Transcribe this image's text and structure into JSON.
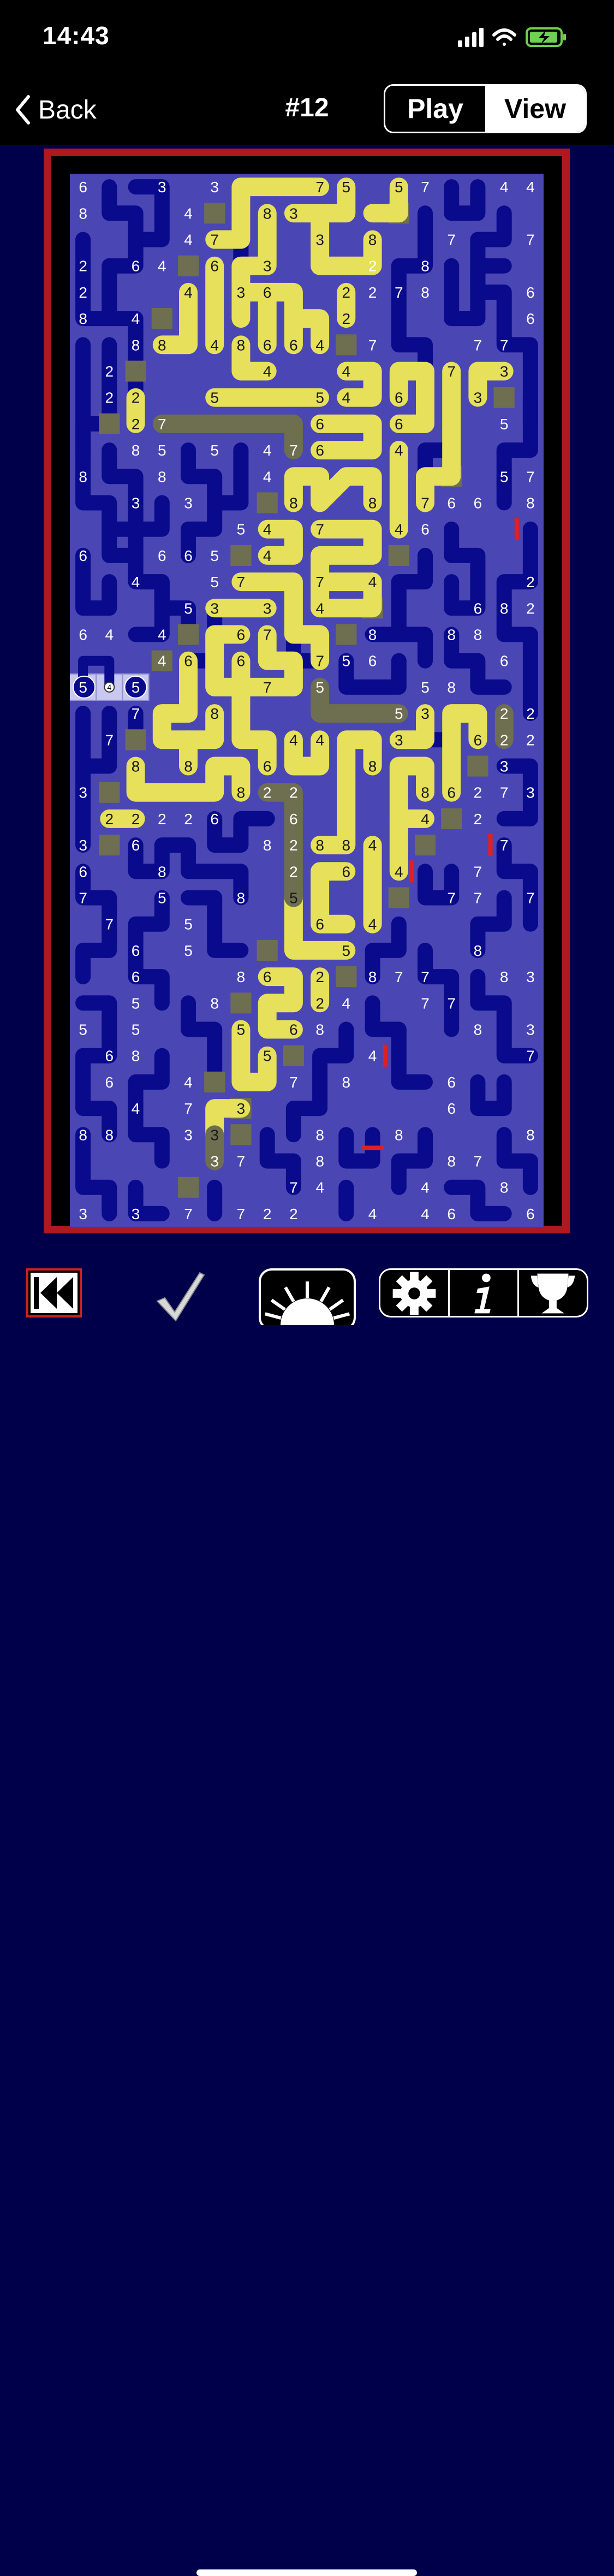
{
  "status": {
    "time": "14:43"
  },
  "nav": {
    "back": "Back",
    "title": "#12",
    "play": "Play",
    "view": "View"
  },
  "colors": {
    "path": "#e6e05a",
    "gray": "#6e6e50",
    "cell": "#4a46b4",
    "pipe": "#0a0a8c",
    "marker": "#e02020",
    "selected": "#c8c8f0"
  },
  "puzzle": {
    "cols": 18,
    "rows": 40,
    "numbers": [
      [
        0,
        0,
        "6",
        "w"
      ],
      [
        0,
        3,
        "3",
        "w"
      ],
      [
        0,
        5,
        "3",
        "w"
      ],
      [
        0,
        9,
        "7",
        "d"
      ],
      [
        0,
        10,
        "5",
        "d"
      ],
      [
        0,
        12,
        "5",
        "d"
      ],
      [
        0,
        13,
        "7",
        "w"
      ],
      [
        0,
        16,
        "4",
        "w"
      ],
      [
        0,
        17,
        "4",
        "w"
      ],
      [
        1,
        0,
        "8",
        "w"
      ],
      [
        1,
        4,
        "4",
        "w"
      ],
      [
        1,
        7,
        "8",
        "d"
      ],
      [
        1,
        8,
        "3",
        "d"
      ],
      [
        2,
        4,
        "4",
        "w"
      ],
      [
        2,
        5,
        "7",
        "d"
      ],
      [
        2,
        9,
        "3",
        "d"
      ],
      [
        2,
        11,
        "8",
        "d"
      ],
      [
        2,
        14,
        "7",
        "w"
      ],
      [
        2,
        17,
        "7",
        "w"
      ],
      [
        3,
        0,
        "2",
        "w"
      ],
      [
        3,
        2,
        "6",
        "w"
      ],
      [
        3,
        3,
        "4",
        "w"
      ],
      [
        3,
        5,
        "6",
        "d"
      ],
      [
        3,
        7,
        "3",
        "d"
      ],
      [
        3,
        11,
        "2",
        "w"
      ],
      [
        3,
        13,
        "8",
        "w"
      ],
      [
        4,
        0,
        "2",
        "w"
      ],
      [
        4,
        4,
        "4",
        "d"
      ],
      [
        4,
        6,
        "3",
        "d"
      ],
      [
        4,
        7,
        "6",
        "d"
      ],
      [
        4,
        10,
        "2",
        "d"
      ],
      [
        4,
        11,
        "2",
        "w"
      ],
      [
        4,
        12,
        "7",
        "w"
      ],
      [
        4,
        13,
        "8",
        "w"
      ],
      [
        4,
        17,
        "6",
        "w"
      ],
      [
        5,
        0,
        "8",
        "w"
      ],
      [
        5,
        2,
        "4",
        "w"
      ],
      [
        5,
        10,
        "2",
        "d"
      ],
      [
        5,
        17,
        "6",
        "w"
      ],
      [
        6,
        2,
        "8",
        "w"
      ],
      [
        6,
        3,
        "8",
        "d"
      ],
      [
        6,
        5,
        "4",
        "d"
      ],
      [
        6,
        6,
        "8",
        "d"
      ],
      [
        6,
        7,
        "6",
        "d"
      ],
      [
        6,
        8,
        "6",
        "d"
      ],
      [
        6,
        9,
        "4",
        "d"
      ],
      [
        6,
        11,
        "7",
        "w"
      ],
      [
        6,
        15,
        "7",
        "w"
      ],
      [
        6,
        16,
        "7",
        "w"
      ],
      [
        7,
        1,
        "2",
        "w"
      ],
      [
        7,
        7,
        "4",
        "d"
      ],
      [
        7,
        10,
        "4",
        "d"
      ],
      [
        7,
        14,
        "7",
        "d"
      ],
      [
        7,
        16,
        "3",
        "d"
      ],
      [
        8,
        1,
        "2",
        "w"
      ],
      [
        8,
        2,
        "2",
        "d"
      ],
      [
        8,
        5,
        "5",
        "d"
      ],
      [
        8,
        9,
        "5",
        "d"
      ],
      [
        8,
        10,
        "4",
        "d"
      ],
      [
        8,
        12,
        "6",
        "d"
      ],
      [
        8,
        15,
        "3",
        "d"
      ],
      [
        9,
        2,
        "2",
        "d"
      ],
      [
        9,
        3,
        "7",
        "w"
      ],
      [
        9,
        9,
        "6",
        "d"
      ],
      [
        9,
        12,
        "6",
        "d"
      ],
      [
        9,
        16,
        "5",
        "w"
      ],
      [
        10,
        2,
        "8",
        "w"
      ],
      [
        10,
        3,
        "5",
        "w"
      ],
      [
        10,
        5,
        "5",
        "w"
      ],
      [
        10,
        7,
        "4",
        "w"
      ],
      [
        10,
        8,
        "7",
        "w"
      ],
      [
        10,
        9,
        "6",
        "d"
      ],
      [
        10,
        12,
        "4",
        "d"
      ],
      [
        11,
        0,
        "8",
        "w"
      ],
      [
        11,
        3,
        "8",
        "w"
      ],
      [
        11,
        7,
        "4",
        "w"
      ],
      [
        11,
        16,
        "5",
        "w"
      ],
      [
        11,
        17,
        "7",
        "w"
      ],
      [
        12,
        2,
        "3",
        "w"
      ],
      [
        12,
        4,
        "3",
        "w"
      ],
      [
        12,
        8,
        "8",
        "d"
      ],
      [
        12,
        11,
        "8",
        "d"
      ],
      [
        12,
        13,
        "7",
        "d"
      ],
      [
        12,
        14,
        "6",
        "w"
      ],
      [
        12,
        15,
        "6",
        "w"
      ],
      [
        12,
        17,
        "8",
        "w"
      ],
      [
        13,
        6,
        "5",
        "w"
      ],
      [
        13,
        7,
        "4",
        "d"
      ],
      [
        13,
        9,
        "7",
        "d"
      ],
      [
        13,
        12,
        "4",
        "d"
      ],
      [
        13,
        13,
        "6",
        "w"
      ],
      [
        14,
        0,
        "6",
        "w"
      ],
      [
        14,
        3,
        "6",
        "w"
      ],
      [
        14,
        4,
        "6",
        "w"
      ],
      [
        14,
        5,
        "5",
        "w"
      ],
      [
        14,
        7,
        "4",
        "d"
      ],
      [
        15,
        2,
        "4",
        "w"
      ],
      [
        15,
        5,
        "5",
        "w"
      ],
      [
        15,
        6,
        "7",
        "d"
      ],
      [
        15,
        9,
        "7",
        "d"
      ],
      [
        15,
        11,
        "4",
        "d"
      ],
      [
        15,
        17,
        "2",
        "w"
      ],
      [
        16,
        4,
        "5",
        "w"
      ],
      [
        16,
        5,
        "3",
        "d"
      ],
      [
        16,
        7,
        "3",
        "d"
      ],
      [
        16,
        9,
        "4",
        "d"
      ],
      [
        16,
        15,
        "6",
        "w"
      ],
      [
        16,
        16,
        "8",
        "w"
      ],
      [
        16,
        17,
        "2",
        "w"
      ],
      [
        17,
        0,
        "6",
        "w"
      ],
      [
        17,
        1,
        "4",
        "w"
      ],
      [
        17,
        3,
        "4",
        "w"
      ],
      [
        17,
        6,
        "6",
        "d"
      ],
      [
        17,
        7,
        "7",
        "d"
      ],
      [
        17,
        11,
        "8",
        "w"
      ],
      [
        17,
        14,
        "8",
        "w"
      ],
      [
        17,
        15,
        "8",
        "w"
      ],
      [
        18,
        3,
        "4",
        "w"
      ],
      [
        18,
        4,
        "6",
        "d"
      ],
      [
        18,
        6,
        "6",
        "d"
      ],
      [
        18,
        9,
        "7",
        "d"
      ],
      [
        18,
        10,
        "5",
        "w"
      ],
      [
        18,
        11,
        "6",
        "w"
      ],
      [
        18,
        16,
        "6",
        "w"
      ],
      [
        19,
        7,
        "7",
        "d"
      ],
      [
        19,
        9,
        "5",
        "w"
      ],
      [
        19,
        13,
        "5",
        "w"
      ],
      [
        19,
        14,
        "8",
        "w"
      ],
      [
        20,
        2,
        "7",
        "w"
      ],
      [
        20,
        5,
        "8",
        "d"
      ],
      [
        20,
        12,
        "5",
        "w"
      ],
      [
        20,
        13,
        "3",
        "d"
      ],
      [
        20,
        16,
        "2",
        "w"
      ],
      [
        20,
        17,
        "2",
        "w"
      ],
      [
        21,
        1,
        "7",
        "w"
      ],
      [
        21,
        8,
        "4",
        "d"
      ],
      [
        21,
        9,
        "4",
        "d"
      ],
      [
        21,
        12,
        "3",
        "d"
      ],
      [
        21,
        15,
        "6",
        "d"
      ],
      [
        21,
        16,
        "2",
        "w"
      ],
      [
        21,
        17,
        "2",
        "w"
      ],
      [
        22,
        2,
        "8",
        "d"
      ],
      [
        22,
        4,
        "8",
        "d"
      ],
      [
        22,
        7,
        "6",
        "d"
      ],
      [
        22,
        11,
        "8",
        "d"
      ],
      [
        22,
        16,
        "3",
        "w"
      ],
      [
        23,
        0,
        "3",
        "w"
      ],
      [
        23,
        6,
        "8",
        "d"
      ],
      [
        23,
        7,
        "2",
        "w"
      ],
      [
        23,
        8,
        "2",
        "w"
      ],
      [
        23,
        13,
        "8",
        "d"
      ],
      [
        23,
        14,
        "6",
        "d"
      ],
      [
        23,
        15,
        "2",
        "w"
      ],
      [
        23,
        16,
        "7",
        "w"
      ],
      [
        23,
        17,
        "3",
        "w"
      ],
      [
        24,
        1,
        "2",
        "d"
      ],
      [
        24,
        2,
        "2",
        "d"
      ],
      [
        24,
        3,
        "2",
        "w"
      ],
      [
        24,
        4,
        "2",
        "w"
      ],
      [
        24,
        5,
        "6",
        "w"
      ],
      [
        24,
        8,
        "6",
        "w"
      ],
      [
        24,
        13,
        "4",
        "d"
      ],
      [
        24,
        15,
        "2",
        "w"
      ],
      [
        25,
        0,
        "3",
        "w"
      ],
      [
        25,
        2,
        "6",
        "w"
      ],
      [
        25,
        7,
        "8",
        "w"
      ],
      [
        25,
        8,
        "2",
        "w"
      ],
      [
        25,
        9,
        "8",
        "d"
      ],
      [
        25,
        10,
        "8",
        "d"
      ],
      [
        25,
        11,
        "4",
        "d"
      ],
      [
        25,
        16,
        "7",
        "w"
      ],
      [
        26,
        0,
        "6",
        "w"
      ],
      [
        26,
        3,
        "8",
        "w"
      ],
      [
        26,
        8,
        "2",
        "w"
      ],
      [
        26,
        10,
        "6",
        "d"
      ],
      [
        26,
        12,
        "4",
        "d"
      ],
      [
        26,
        15,
        "7",
        "w"
      ],
      [
        27,
        0,
        "7",
        "w"
      ],
      [
        27,
        3,
        "5",
        "w"
      ],
      [
        27,
        6,
        "8",
        "w"
      ],
      [
        27,
        8,
        "5",
        "d"
      ],
      [
        27,
        14,
        "7",
        "w"
      ],
      [
        27,
        15,
        "7",
        "w"
      ],
      [
        27,
        17,
        "7",
        "w"
      ],
      [
        28,
        1,
        "7",
        "w"
      ],
      [
        28,
        4,
        "5",
        "w"
      ],
      [
        28,
        9,
        "6",
        "d"
      ],
      [
        28,
        11,
        "4",
        "d"
      ],
      [
        29,
        2,
        "6",
        "w"
      ],
      [
        29,
        4,
        "5",
        "w"
      ],
      [
        29,
        10,
        "5",
        "d"
      ],
      [
        29,
        15,
        "8",
        "w"
      ],
      [
        30,
        2,
        "6",
        "w"
      ],
      [
        30,
        6,
        "8",
        "w"
      ],
      [
        30,
        7,
        "6",
        "d"
      ],
      [
        30,
        9,
        "2",
        "d"
      ],
      [
        30,
        11,
        "8",
        "w"
      ],
      [
        30,
        12,
        "7",
        "w"
      ],
      [
        30,
        13,
        "7",
        "w"
      ],
      [
        30,
        16,
        "8",
        "w"
      ],
      [
        30,
        17,
        "3",
        "w"
      ],
      [
        31,
        2,
        "5",
        "w"
      ],
      [
        31,
        5,
        "8",
        "w"
      ],
      [
        31,
        9,
        "2",
        "d"
      ],
      [
        31,
        10,
        "4",
        "w"
      ],
      [
        31,
        13,
        "7",
        "w"
      ],
      [
        31,
        14,
        "7",
        "w"
      ],
      [
        32,
        0,
        "5",
        "w"
      ],
      [
        32,
        2,
        "5",
        "w"
      ],
      [
        32,
        6,
        "5",
        "d"
      ],
      [
        32,
        8,
        "6",
        "d"
      ],
      [
        32,
        9,
        "8",
        "w"
      ],
      [
        32,
        15,
        "8",
        "w"
      ],
      [
        32,
        17,
        "3",
        "w"
      ],
      [
        33,
        1,
        "6",
        "w"
      ],
      [
        33,
        2,
        "8",
        "w"
      ],
      [
        33,
        7,
        "5",
        "d"
      ],
      [
        33,
        11,
        "4",
        "w"
      ],
      [
        33,
        17,
        "7",
        "w"
      ],
      [
        34,
        1,
        "6",
        "w"
      ],
      [
        34,
        4,
        "4",
        "w"
      ],
      [
        34,
        8,
        "7",
        "w"
      ],
      [
        34,
        10,
        "8",
        "w"
      ],
      [
        34,
        14,
        "6",
        "w"
      ],
      [
        35,
        2,
        "4",
        "w"
      ],
      [
        35,
        4,
        "7",
        "w"
      ],
      [
        35,
        6,
        "3",
        "d"
      ],
      [
        35,
        14,
        "6",
        "w"
      ],
      [
        36,
        0,
        "8",
        "w"
      ],
      [
        36,
        1,
        "8",
        "w"
      ],
      [
        36,
        4,
        "3",
        "w"
      ],
      [
        36,
        5,
        "3",
        "d"
      ],
      [
        36,
        9,
        "8",
        "w"
      ],
      [
        36,
        12,
        "8",
        "w"
      ],
      [
        36,
        17,
        "8",
        "w"
      ],
      [
        37,
        5,
        "3",
        "w"
      ],
      [
        37,
        6,
        "7",
        "w"
      ],
      [
        37,
        9,
        "8",
        "w"
      ],
      [
        37,
        14,
        "8",
        "w"
      ],
      [
        37,
        15,
        "7",
        "w"
      ],
      [
        38,
        8,
        "7",
        "w"
      ],
      [
        38,
        9,
        "4",
        "w"
      ],
      [
        38,
        13,
        "4",
        "w"
      ],
      [
        38,
        16,
        "8",
        "w"
      ],
      [
        39,
        0,
        "3",
        "w"
      ],
      [
        39,
        2,
        "3",
        "w"
      ],
      [
        39,
        4,
        "7",
        "w"
      ],
      [
        39,
        6,
        "7",
        "w"
      ],
      [
        39,
        7,
        "2",
        "w"
      ],
      [
        39,
        8,
        "2",
        "w"
      ],
      [
        39,
        11,
        "4",
        "w"
      ],
      [
        39,
        13,
        "4",
        "w"
      ],
      [
        39,
        14,
        "6",
        "w"
      ],
      [
        39,
        17,
        "6",
        "w"
      ]
    ],
    "gray_cells": [
      [
        1,
        5
      ],
      [
        1,
        12
      ],
      [
        3,
        4
      ],
      [
        5,
        3
      ],
      [
        6,
        10
      ],
      [
        7,
        2
      ],
      [
        8,
        16
      ],
      [
        9,
        1
      ],
      [
        11,
        14
      ],
      [
        12,
        7
      ],
      [
        14,
        6
      ],
      [
        14,
        12
      ],
      [
        16,
        11
      ],
      [
        17,
        4
      ],
      [
        17,
        10
      ],
      [
        18,
        3
      ],
      [
        21,
        2
      ],
      [
        22,
        15
      ],
      [
        23,
        1
      ],
      [
        24,
        14
      ],
      [
        25,
        1
      ],
      [
        25,
        13
      ],
      [
        27,
        12
      ],
      [
        29,
        7
      ],
      [
        30,
        10
      ],
      [
        31,
        6
      ],
      [
        33,
        8
      ],
      [
        34,
        5
      ],
      [
        35,
        6
      ],
      [
        36,
        6
      ],
      [
        38,
        4
      ]
    ],
    "selected": {
      "row": 19,
      "cells": [
        0,
        1,
        2
      ],
      "values": [
        "5",
        "4",
        "5"
      ]
    },
    "red_markers": [
      [
        13,
        16,
        "v"
      ],
      [
        25,
        15,
        "v"
      ],
      [
        26,
        12,
        "v"
      ],
      [
        33,
        11,
        "v"
      ],
      [
        36,
        11,
        "h"
      ]
    ]
  },
  "toolbar": {
    "rewind": "rewind-icon",
    "check": "check-icon",
    "hint": "sunburst-icon",
    "settings": "gear-icon",
    "info": "info-icon",
    "trophy": "trophy-icon"
  }
}
